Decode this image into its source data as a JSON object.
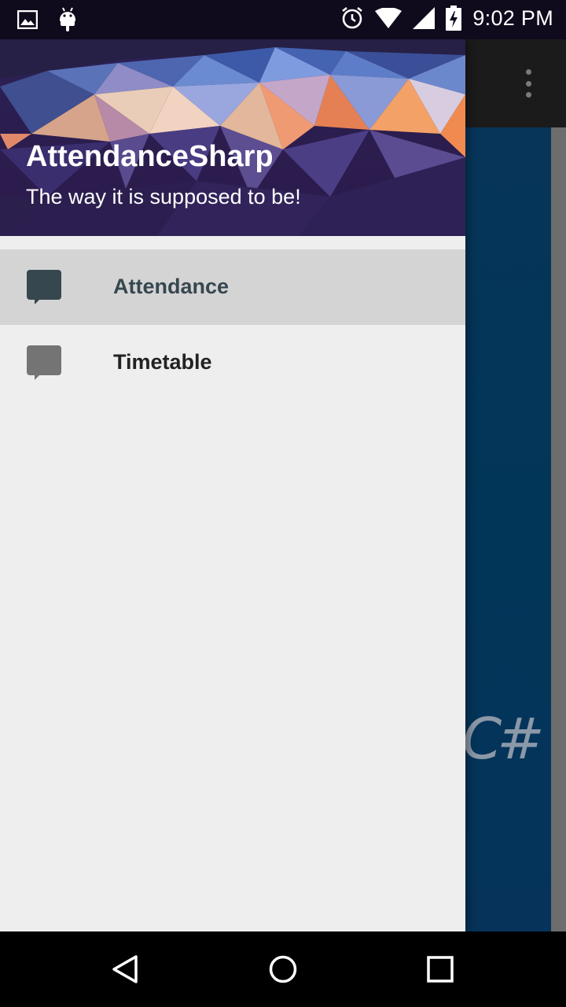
{
  "status_bar": {
    "time": "9:02 PM",
    "left_icons": [
      "image-icon",
      "android-icon"
    ],
    "right_icons": [
      "alarm-icon",
      "wifi-icon",
      "signal-icon",
      "battery-charging-icon"
    ]
  },
  "drawer": {
    "title": "AttendanceSharp",
    "subtitle": "The way it is supposed to be!",
    "items": [
      {
        "label": "Attendance",
        "icon": "chat-bubble-icon",
        "selected": true
      },
      {
        "label": "Timetable",
        "icon": "chat-bubble-icon",
        "selected": false
      }
    ]
  },
  "background": {
    "logo_fragment": "C#"
  },
  "nav_bar": {
    "buttons": [
      "back-icon",
      "home-icon",
      "recents-icon"
    ]
  },
  "colors": {
    "selected_bg": "#d4d4d4",
    "drawer_bg": "#eeeeee",
    "selected_text": "#37474f",
    "app_content_bg": "#023659"
  }
}
